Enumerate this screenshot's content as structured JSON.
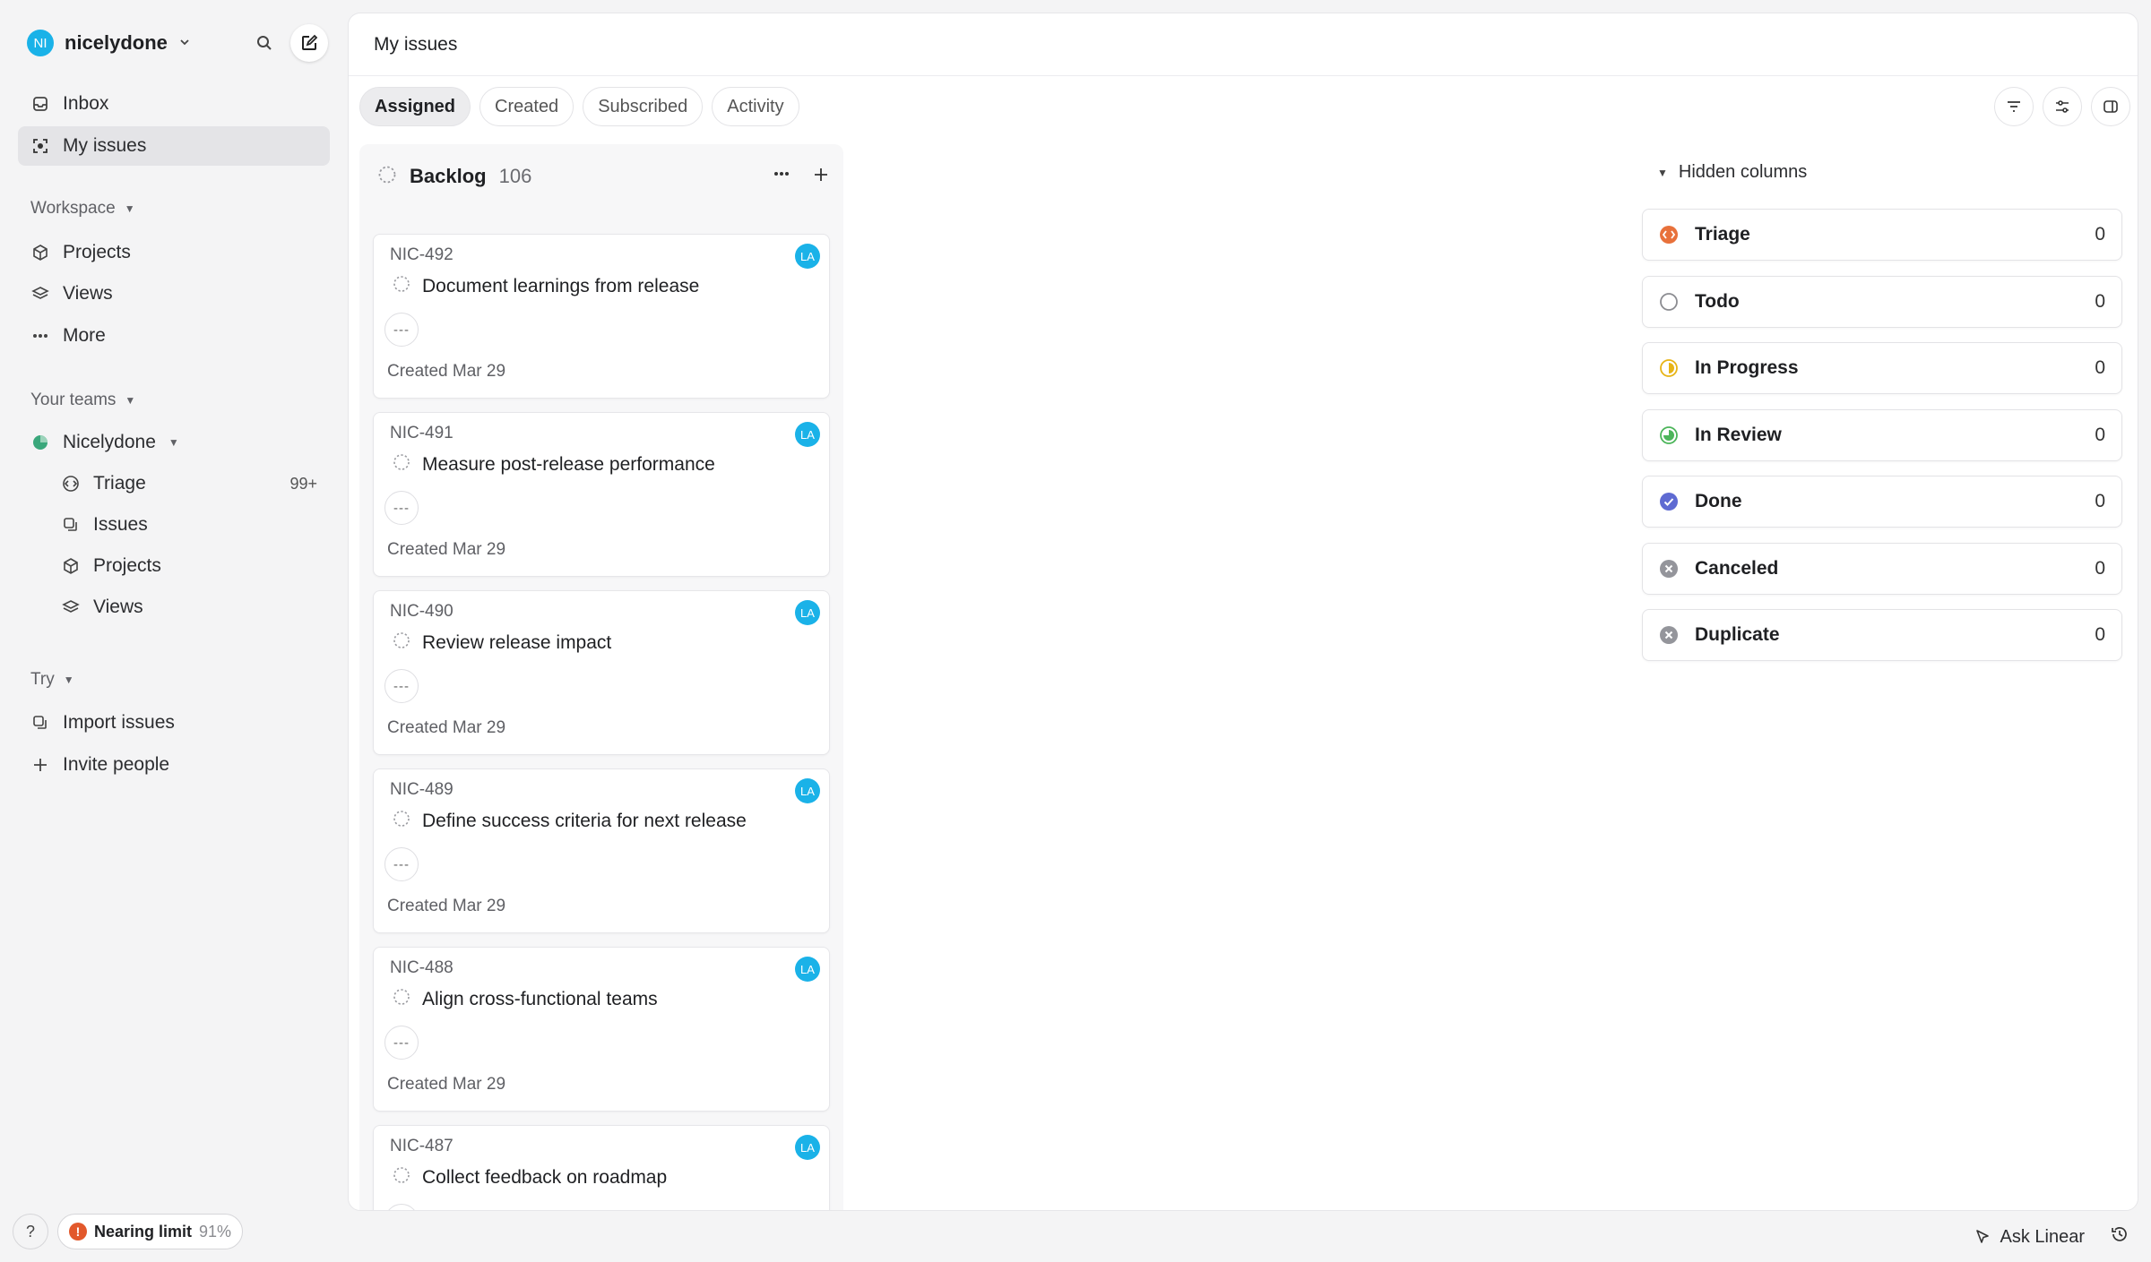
{
  "workspace": {
    "name": "nicelydone",
    "avatar": "NI"
  },
  "nav": {
    "inbox": "Inbox",
    "my_issues": "My issues"
  },
  "workspace_section": {
    "label": "Workspace",
    "projects": "Projects",
    "views": "Views",
    "more": "More"
  },
  "teams_section": {
    "label": "Your teams",
    "team_name": "Nicelydone",
    "triage": "Triage",
    "triage_count": "99+",
    "issues": "Issues",
    "projects": "Projects",
    "views": "Views"
  },
  "try_section": {
    "label": "Try",
    "import": "Import issues",
    "invite": "Invite people"
  },
  "bottom": {
    "help": "?",
    "limit_label": "Nearing limit",
    "limit_pct": "91%"
  },
  "header": {
    "title": "My issues"
  },
  "tabs": [
    {
      "label": "Assigned"
    },
    {
      "label": "Created"
    },
    {
      "label": "Subscribed"
    },
    {
      "label": "Activity"
    }
  ],
  "backlog": {
    "title": "Backlog",
    "count": "106",
    "cards": [
      {
        "id": "NIC-492",
        "title": "Document learnings from release",
        "created": "Created Mar 29",
        "assignee": "LA",
        "priority": "---"
      },
      {
        "id": "NIC-491",
        "title": "Measure post-release performance",
        "created": "Created Mar 29",
        "assignee": "LA",
        "priority": "---"
      },
      {
        "id": "NIC-490",
        "title": "Review release impact",
        "created": "Created Mar 29",
        "assignee": "LA",
        "priority": "---"
      },
      {
        "id": "NIC-489",
        "title": "Define success criteria for next release",
        "created": "Created Mar 29",
        "assignee": "LA",
        "priority": "---"
      },
      {
        "id": "NIC-488",
        "title": "Align cross-functional teams",
        "created": "Created Mar 29",
        "assignee": "LA",
        "priority": "---"
      },
      {
        "id": "NIC-487",
        "title": "Collect feedback on roadmap",
        "created": "",
        "assignee": "LA",
        "priority": "---"
      }
    ]
  },
  "hidden_columns": {
    "label": "Hidden columns",
    "items": [
      {
        "name": "Triage",
        "count": "0",
        "color": "#e8713b"
      },
      {
        "name": "Todo",
        "count": "0",
        "color": "#8b8c91"
      },
      {
        "name": "In Progress",
        "count": "0",
        "color": "#e7b416"
      },
      {
        "name": "In Review",
        "count": "0",
        "color": "#4cb55a"
      },
      {
        "name": "Done",
        "count": "0",
        "color": "#5e6ad2"
      },
      {
        "name": "Canceled",
        "count": "0",
        "color": "#94959b"
      },
      {
        "name": "Duplicate",
        "count": "0",
        "color": "#94959b"
      }
    ]
  },
  "footer": {
    "ask": "Ask Linear"
  },
  "colors": {
    "accent": "#1ab2e8",
    "warning": "#e2582b"
  }
}
